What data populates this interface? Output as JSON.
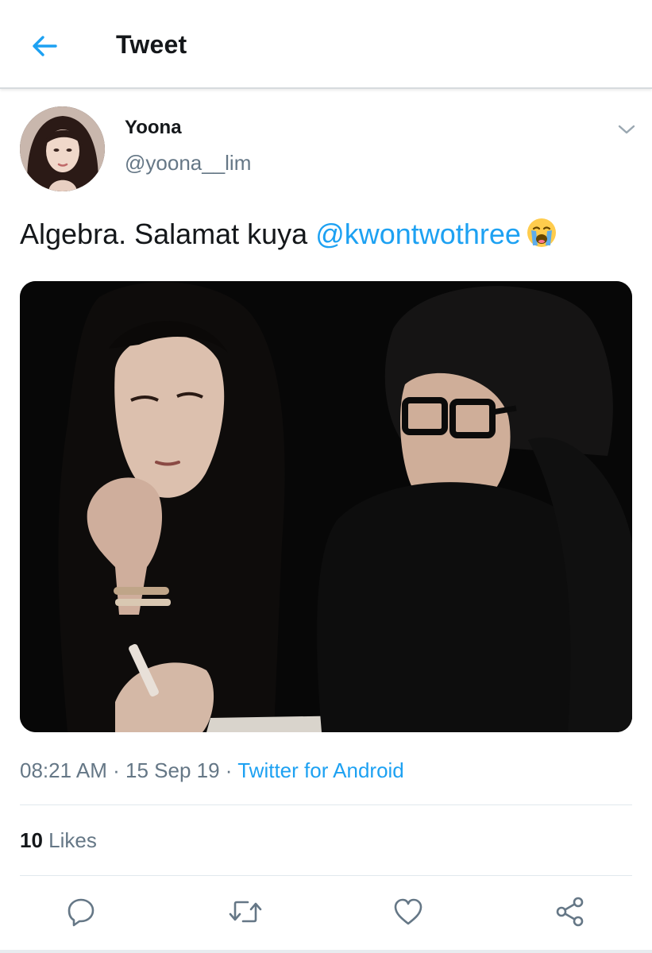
{
  "header": {
    "title": "Tweet",
    "back_icon": "arrow-left-icon"
  },
  "tweet": {
    "author": {
      "display_name": "Yoona",
      "handle": "@yoona__lim"
    },
    "text_prefix": "Algebra. Salamat kuya ",
    "mention": "@kwontwothree",
    "emoji": "loudly-crying-face",
    "timestamp": "08:21 AM",
    "separator": "·",
    "date": "15 Sep 19",
    "source": "Twitter for Android",
    "likes_count": "10",
    "likes_label": "Likes"
  },
  "actions": [
    {
      "name": "reply",
      "icon": "reply-icon"
    },
    {
      "name": "retweet",
      "icon": "retweet-icon"
    },
    {
      "name": "like",
      "icon": "heart-icon"
    },
    {
      "name": "share",
      "icon": "share-icon"
    }
  ],
  "colors": {
    "accent": "#1da1f2",
    "text": "#14171a",
    "secondary": "#657786",
    "divider": "#e1e8ed"
  }
}
